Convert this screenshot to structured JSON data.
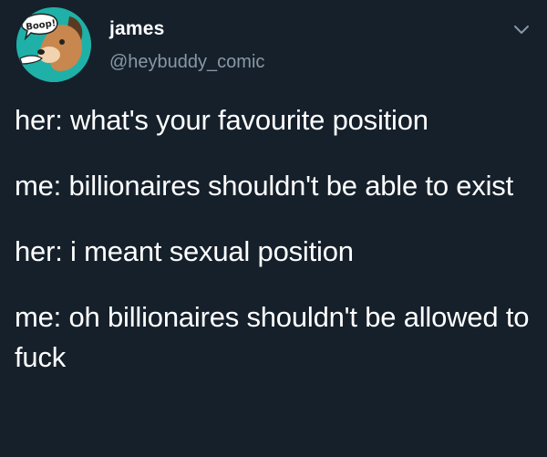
{
  "tweet": {
    "author": {
      "display_name": "james",
      "handle": "@heybuddy_comic",
      "avatar_text": "Boop!"
    },
    "menu_icon": "chevron-down-icon",
    "lines": [
      "her: what's your favourite position",
      "me: billionaires shouldn't be able to exist",
      "her: i meant sexual position",
      "me: oh billionaires shouldn't be allowed to fuck"
    ]
  },
  "colors": {
    "background": "#15202b",
    "text_primary": "#ffffff",
    "text_secondary": "#8899a6",
    "avatar_bg": "#1fb1a8"
  }
}
